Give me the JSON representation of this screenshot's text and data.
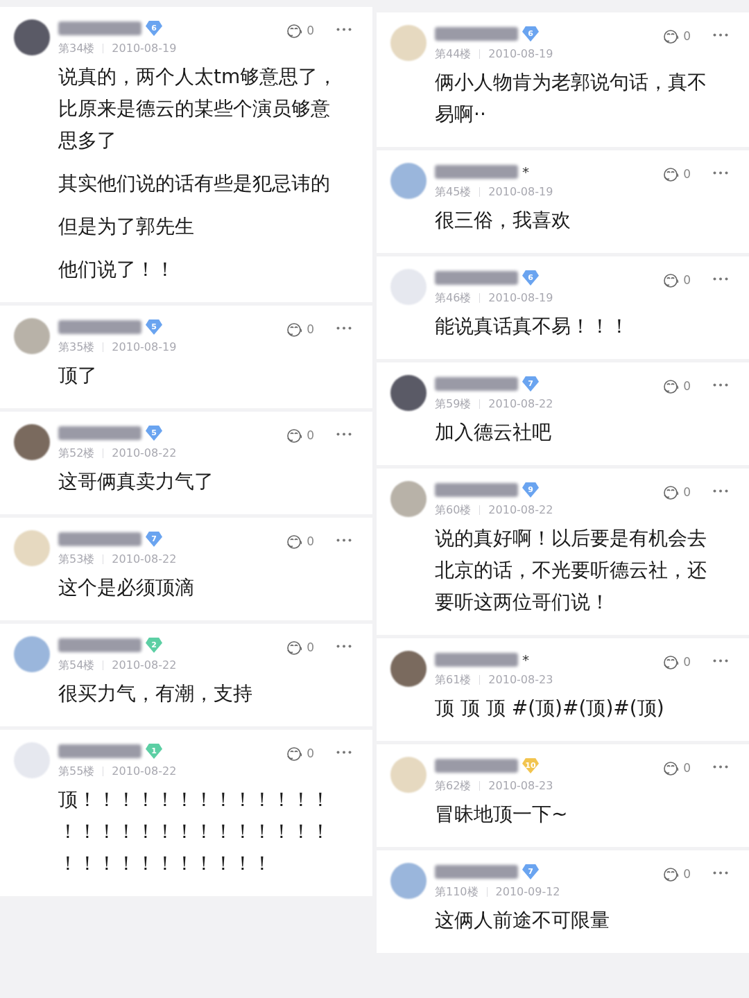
{
  "columns": [
    {
      "comments": [
        {
          "badge": {
            "level": "6",
            "color": "#6aa4f0"
          },
          "floor": "第34楼",
          "date": "2010-08-19",
          "likes": "0",
          "paragraphs": [
            "说真的，两个人太tm够意思了，比原来是德云的某些个演员够意思多了",
            "其实他们说的话有些是犯忌讳的",
            "但是为了郭先生",
            "他们说了！！"
          ]
        },
        {
          "badge": {
            "level": "5",
            "color": "#6aa4f0"
          },
          "floor": "第35楼",
          "date": "2010-08-19",
          "likes": "0",
          "paragraphs": [
            "顶了"
          ]
        },
        {
          "badge": {
            "level": "5",
            "color": "#6aa4f0"
          },
          "floor": "第52楼",
          "date": "2010-08-22",
          "likes": "0",
          "paragraphs": [
            "这哥俩真卖力气了"
          ]
        },
        {
          "badge": {
            "level": "7",
            "color": "#6aa4f0"
          },
          "floor": "第53楼",
          "date": "2010-08-22",
          "likes": "0",
          "paragraphs": [
            "这个是必须顶滴"
          ]
        },
        {
          "badge": {
            "level": "2",
            "color": "#5ccfa4"
          },
          "floor": "第54楼",
          "date": "2010-08-22",
          "likes": "0",
          "paragraphs": [
            "很买力气，有潮，支持"
          ]
        },
        {
          "badge": {
            "level": "1",
            "color": "#5ccfa4"
          },
          "floor": "第55楼",
          "date": "2010-08-22",
          "likes": "0",
          "paragraphs": [
            "顶！！！！！！！！！！！！！！！！！！！！！！！！！！！！！！！！！！！！！！"
          ]
        }
      ]
    },
    {
      "comments": [
        {
          "badge": {
            "level": "6",
            "color": "#6aa4f0"
          },
          "floor": "第44楼",
          "date": "2010-08-19",
          "likes": "0",
          "paragraphs": [
            "俩小人物肯为老郭说句话，真不易啊··"
          ]
        },
        {
          "name_suffix": "*",
          "floor": "第45楼",
          "date": "2010-08-19",
          "likes": "0",
          "paragraphs": [
            "很三俗，我喜欢"
          ]
        },
        {
          "badge": {
            "level": "6",
            "color": "#6aa4f0"
          },
          "floor": "第46楼",
          "date": "2010-08-19",
          "likes": "0",
          "paragraphs": [
            "能说真话真不易！！！"
          ]
        },
        {
          "badge": {
            "level": "7",
            "color": "#6aa4f0"
          },
          "floor": "第59楼",
          "date": "2010-08-22",
          "likes": "0",
          "paragraphs": [
            "加入德云社吧"
          ]
        },
        {
          "badge": {
            "level": "9",
            "color": "#6aa4f0"
          },
          "floor": "第60楼",
          "date": "2010-08-22",
          "likes": "0",
          "paragraphs": [
            "说的真好啊！以后要是有机会去北京的话，不光要听德云社，还要听这两位哥们说！"
          ]
        },
        {
          "name_suffix": "*",
          "floor": "第61楼",
          "date": "2010-08-23",
          "likes": "0",
          "paragraphs": [
            "顶 顶 顶 #(顶)#(顶)#(顶)"
          ]
        },
        {
          "badge": {
            "level": "10",
            "color": "#f2c44e"
          },
          "floor": "第62楼",
          "date": "2010-08-23",
          "likes": "0",
          "paragraphs": [
            "冒昧地顶一下~"
          ]
        },
        {
          "badge": {
            "level": "7",
            "color": "#6aa4f0"
          },
          "floor": "第110楼",
          "date": "2010-09-12",
          "likes": "0",
          "paragraphs": [
            "这俩人前途不可限量"
          ]
        }
      ]
    }
  ]
}
